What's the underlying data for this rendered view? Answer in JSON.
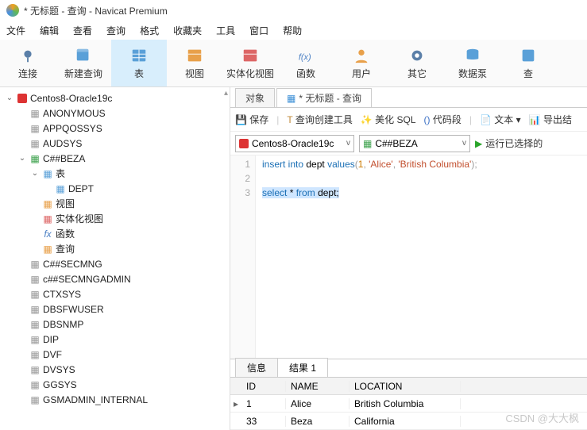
{
  "title": "* 无标题 - 查询 - Navicat Premium",
  "menu": [
    "文件",
    "编辑",
    "查看",
    "查询",
    "格式",
    "收藏夹",
    "工具",
    "窗口",
    "帮助"
  ],
  "toolbar": [
    {
      "label": "连接",
      "icon": "plug"
    },
    {
      "label": "新建查询",
      "icon": "grid-plus"
    },
    {
      "label": "表",
      "icon": "table",
      "sel": true
    },
    {
      "label": "视图",
      "icon": "view"
    },
    {
      "label": "实体化视图",
      "icon": "matview"
    },
    {
      "label": "函数",
      "icon": "fx"
    },
    {
      "label": "用户",
      "icon": "user"
    },
    {
      "label": "其它",
      "icon": "gear"
    },
    {
      "label": "数据泵",
      "icon": "db"
    },
    {
      "label": "查",
      "icon": "q"
    }
  ],
  "tree": [
    {
      "ind": 0,
      "chv": "v",
      "ic": "conn-red",
      "t": "Centos8-Oracle19c"
    },
    {
      "ind": 1,
      "chv": "",
      "ic": "schema",
      "t": "ANONYMOUS"
    },
    {
      "ind": 1,
      "chv": "",
      "ic": "schema",
      "t": "APPQOSSYS"
    },
    {
      "ind": 1,
      "chv": "",
      "ic": "schema",
      "t": "AUDSYS"
    },
    {
      "ind": 1,
      "chv": "v",
      "ic": "schema-g",
      "t": "C##BEZA"
    },
    {
      "ind": 2,
      "chv": "v",
      "ic": "table",
      "t": "表"
    },
    {
      "ind": 3,
      "chv": "",
      "ic": "table",
      "t": "DEPT"
    },
    {
      "ind": 2,
      "chv": "",
      "ic": "view",
      "t": "视图"
    },
    {
      "ind": 2,
      "chv": "",
      "ic": "matview",
      "t": "实体化视图"
    },
    {
      "ind": 2,
      "chv": "",
      "ic": "fx",
      "t": "函数"
    },
    {
      "ind": 2,
      "chv": "",
      "ic": "query",
      "t": "查询"
    },
    {
      "ind": 1,
      "chv": "",
      "ic": "schema",
      "t": "C##SECMNG"
    },
    {
      "ind": 1,
      "chv": "",
      "ic": "schema",
      "t": "c##SECMNGADMIN"
    },
    {
      "ind": 1,
      "chv": "",
      "ic": "schema",
      "t": "CTXSYS"
    },
    {
      "ind": 1,
      "chv": "",
      "ic": "schema",
      "t": "DBSFWUSER"
    },
    {
      "ind": 1,
      "chv": "",
      "ic": "schema",
      "t": "DBSNMP"
    },
    {
      "ind": 1,
      "chv": "",
      "ic": "schema",
      "t": "DIP"
    },
    {
      "ind": 1,
      "chv": "",
      "ic": "schema",
      "t": "DVF"
    },
    {
      "ind": 1,
      "chv": "",
      "ic": "schema",
      "t": "DVSYS"
    },
    {
      "ind": 1,
      "chv": "",
      "ic": "schema",
      "t": "GGSYS"
    },
    {
      "ind": 1,
      "chv": "",
      "ic": "schema",
      "t": "GSMADMIN_INTERNAL"
    }
  ],
  "rtabs": {
    "obj": "对象",
    "query": "* 无标题 - 查询"
  },
  "qtool": {
    "save": "保存",
    "builder": "查询创建工具",
    "beautify": "美化 SQL",
    "snippet": "代码段",
    "text": "文本",
    "export": "导出结"
  },
  "conn_sel": "Centos8-Oracle19c",
  "schema_sel": "C##BEZA",
  "run": "运行已选择的",
  "code_lines": [
    "1",
    "2",
    "3"
  ],
  "sql": {
    "l1a": "insert into",
    "l1b": "dept",
    "l1c": "values",
    "l1n": "1",
    "l1s1": "'Alice'",
    "l1s2": "'British Columbia'",
    "l3a": "select",
    "l3b": "*",
    "l3c": "from",
    "l3d": "dept;"
  },
  "btabs": {
    "info": "信息",
    "res": "结果 1"
  },
  "cols": [
    "ID",
    "NAME",
    "LOCATION"
  ],
  "rows": [
    {
      "id": "1",
      "name": "Alice",
      "loc": "British Columbia",
      "cur": true
    },
    {
      "id": "33",
      "name": "Beza",
      "loc": "California",
      "cur": false
    }
  ],
  "watermark": "CSDN @大大枫"
}
